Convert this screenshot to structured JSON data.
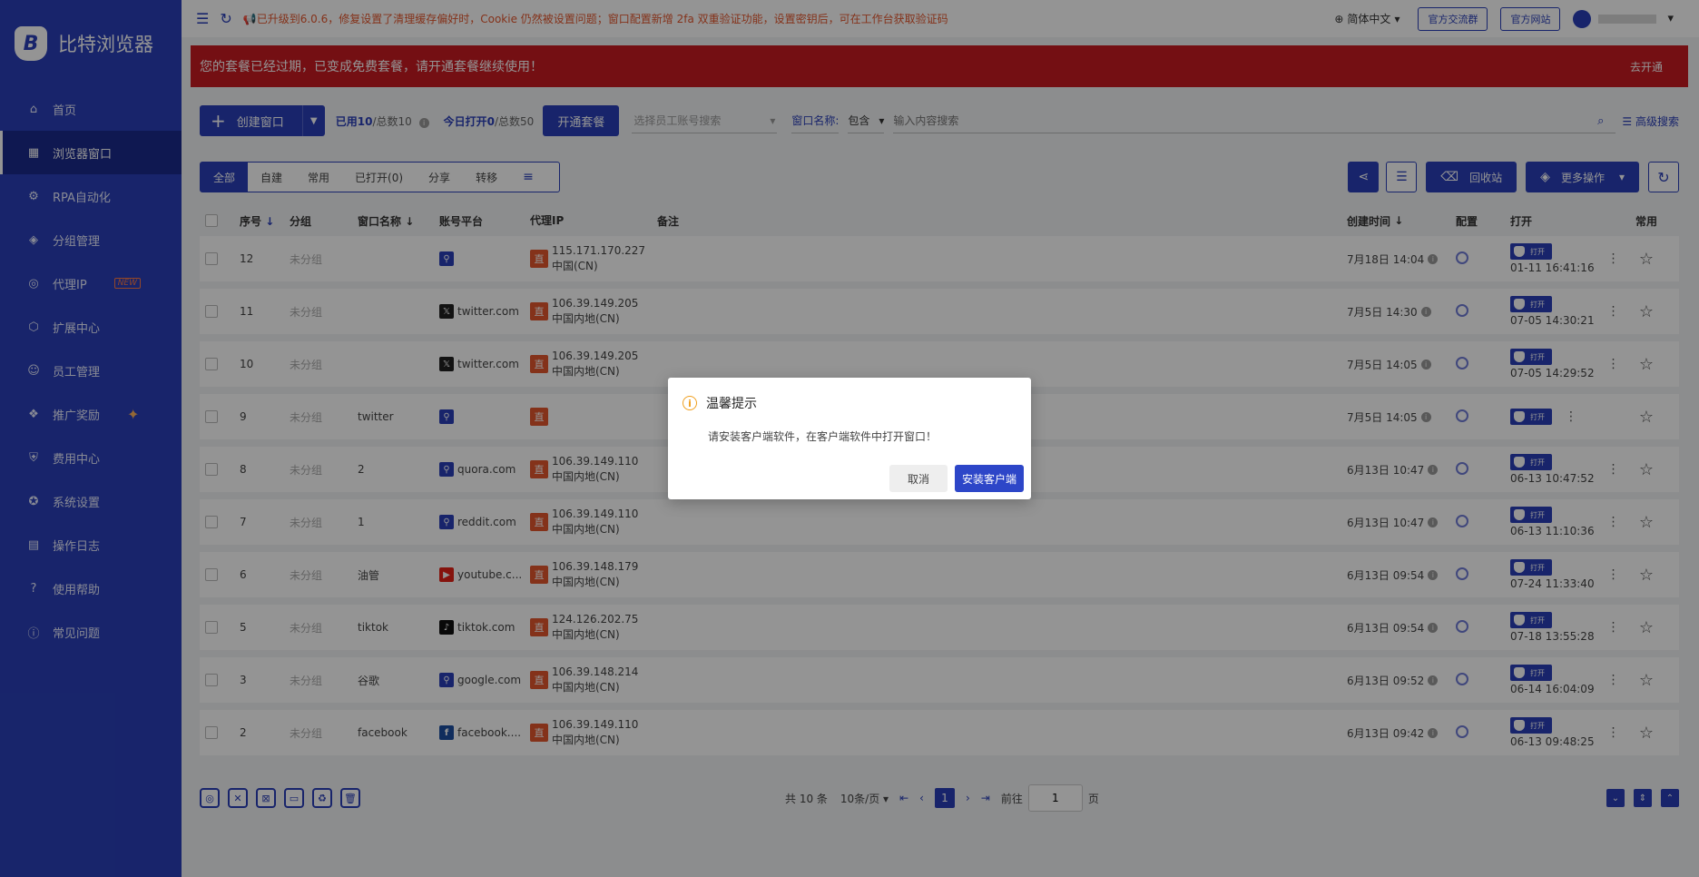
{
  "app": {
    "name": "比特浏览器"
  },
  "sidebar": {
    "items": [
      {
        "label": "首页",
        "icon": "home-icon",
        "glyph": "⌂"
      },
      {
        "label": "浏览器窗口",
        "icon": "grid-icon",
        "glyph": "▦",
        "active": true
      },
      {
        "label": "RPA自动化",
        "icon": "robot-icon",
        "glyph": "⚙"
      },
      {
        "label": "分组管理",
        "icon": "layers-icon",
        "glyph": "◈"
      },
      {
        "label": "代理IP",
        "icon": "location-icon",
        "glyph": "◎",
        "badge": "NEW"
      },
      {
        "label": "扩展中心",
        "icon": "cube-icon",
        "glyph": "⬡"
      },
      {
        "label": "员工管理",
        "icon": "users-icon",
        "glyph": "☺"
      },
      {
        "label": "推广奖励",
        "icon": "gift-icon",
        "glyph": "❖",
        "spark": "✦"
      },
      {
        "label": "费用中心",
        "icon": "shield-icon",
        "glyph": "⛨"
      },
      {
        "label": "系统设置",
        "icon": "settings-icon",
        "glyph": "✪"
      },
      {
        "label": "操作日志",
        "icon": "log-icon",
        "glyph": "▤"
      },
      {
        "label": "使用帮助",
        "icon": "help-icon",
        "glyph": "?"
      },
      {
        "label": "常见问题",
        "icon": "faq-icon",
        "glyph": "ⓘ"
      }
    ]
  },
  "topbar": {
    "notice": "📢已升级到6.0.6，修复设置了清理缓存偏好时，Cookie 仍然被设置问题；窗口配置新增 2fa 双重验证功能，设置密钥后，可在工作台获取验证码",
    "language": "简体中文",
    "btn_community": "官方交流群",
    "btn_site": "官方网站"
  },
  "banner": {
    "text": "您的套餐已经过期，已变成免费套餐，请开通套餐继续使用！",
    "action": "去开通"
  },
  "toolbar": {
    "create": "创建窗口",
    "used_label": "已用10",
    "total_label": "/总数10",
    "today_label": "今日打开0",
    "today_total": "/总数50",
    "plan_btn": "开通套餐",
    "staff_placeholder": "选择员工账号搜索",
    "filter_label": "窗口名称:",
    "filter_op": "包含",
    "search_placeholder": "输入内容搜索",
    "advanced": "高级搜索"
  },
  "tabs": [
    "全部",
    "自建",
    "常用",
    "已打开(0)",
    "分享",
    "转移"
  ],
  "actions": {
    "recycle": "回收站",
    "more": "更多操作"
  },
  "table": {
    "headers": {
      "no": "序号",
      "group": "分组",
      "name": "窗口名称",
      "platform": "账号平台",
      "ip": "代理IP",
      "note": "备注",
      "created": "创建时间",
      "config": "配置",
      "open": "打开",
      "fav": "常用"
    },
    "open_label": "打开",
    "rows": [
      {
        "no": "12",
        "group": "未分组",
        "name": "",
        "platform": "",
        "picon": "link",
        "ip": "115.171.170.227",
        "region": "中国(CN)",
        "created": "7月18日 14:04",
        "opened": "01-11 16:41:16"
      },
      {
        "no": "11",
        "group": "未分组",
        "name": "",
        "platform": "twitter.com",
        "picon": "x",
        "ip": "106.39.149.205",
        "region": "中国内地(CN)",
        "created": "7月5日 14:30",
        "opened": "07-05 14:30:21"
      },
      {
        "no": "10",
        "group": "未分组",
        "name": "",
        "platform": "twitter.com",
        "picon": "x",
        "ip": "106.39.149.205",
        "region": "中国内地(CN)",
        "created": "7月5日 14:05",
        "opened": "07-05 14:29:52"
      },
      {
        "no": "9",
        "group": "未分组",
        "name": "twitter",
        "platform": "",
        "picon": "link",
        "ip": "",
        "region": "",
        "created": "7月5日 14:05",
        "opened": ""
      },
      {
        "no": "8",
        "group": "未分组",
        "name": "2",
        "platform": "quora.com",
        "picon": "link",
        "ip": "106.39.149.110",
        "region": "中国内地(CN)",
        "created": "6月13日 10:47",
        "opened": "06-13 10:47:52"
      },
      {
        "no": "7",
        "group": "未分组",
        "name": "1",
        "platform": "reddit.com",
        "picon": "link",
        "ip": "106.39.149.110",
        "region": "中国内地(CN)",
        "created": "6月13日 10:47",
        "opened": "06-13 11:10:36"
      },
      {
        "no": "6",
        "group": "未分组",
        "name": "油管",
        "platform": "youtube.c...",
        "picon": "yt",
        "ip": "106.39.148.179",
        "region": "中国内地(CN)",
        "created": "6月13日 09:54",
        "opened": "07-24 11:33:40"
      },
      {
        "no": "5",
        "group": "未分组",
        "name": "tiktok",
        "platform": "tiktok.com",
        "picon": "tt",
        "ip": "124.126.202.75",
        "region": "中国内地(CN)",
        "created": "6月13日 09:54",
        "opened": "07-18 13:55:28"
      },
      {
        "no": "3",
        "group": "未分组",
        "name": "谷歌",
        "platform": "google.com",
        "picon": "link",
        "ip": "106.39.148.214",
        "region": "中国内地(CN)",
        "created": "6月13日 09:52",
        "opened": "06-14 16:04:09"
      },
      {
        "no": "2",
        "group": "未分组",
        "name": "facebook",
        "platform": "facebook....",
        "picon": "fb",
        "ip": "106.39.149.110",
        "region": "中国内地(CN)",
        "created": "6月13日 09:42",
        "opened": "06-13 09:48:25"
      }
    ]
  },
  "pagination": {
    "total": "共 10 条",
    "page_size": "10条/页",
    "current": "1",
    "goto_label": "前往",
    "goto_value": "1",
    "page_unit": "页"
  },
  "dialog": {
    "title": "温馨提示",
    "body": "请安装客户端软件，在客户端软件中打开窗口！",
    "cancel": "取消",
    "confirm": "安装客户端"
  },
  "colors": {
    "brand": "#2a3fb8",
    "danger": "#c81a22",
    "ip_badge": "#e4572e",
    "warn": "#f0a020"
  }
}
